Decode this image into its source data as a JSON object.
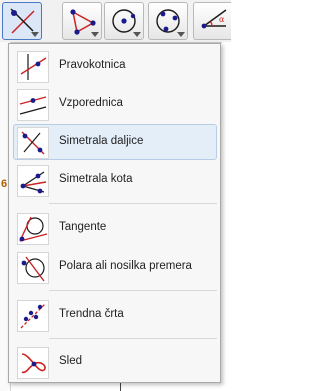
{
  "colors": {
    "accent": "#1a1a8c",
    "line_red": "#cc2222",
    "selected_bg": "#e4eef9"
  },
  "toolbar": {
    "buttons": [
      {
        "name": "perpendicular-tool-icon",
        "active": true
      },
      {
        "name": "triangle-points-tool-icon",
        "active": false
      },
      {
        "name": "circle-center-tool-icon",
        "active": false
      },
      {
        "name": "circle-three-points-tool-icon",
        "active": false
      },
      {
        "name": "angle-tool-icon",
        "active": false
      }
    ]
  },
  "side_label": "6",
  "menu": {
    "items": [
      {
        "label": "Pravokotnica",
        "icon": "perpendicular-line-icon",
        "selected": false
      },
      {
        "label": "Vzporednica",
        "icon": "parallel-line-icon",
        "selected": false
      },
      {
        "label": "Simetrala daljice",
        "icon": "perpendicular-bisector-icon",
        "selected": true
      },
      {
        "label": "Simetrala kota",
        "icon": "angle-bisector-icon",
        "selected": false
      },
      {
        "label": "Tangente",
        "icon": "tangents-icon",
        "selected": false
      },
      {
        "label": "Polara ali nosilka premera",
        "icon": "polar-line-icon",
        "selected": false
      },
      {
        "label": "Trendna črta",
        "icon": "best-fit-line-icon",
        "selected": false
      },
      {
        "label": "Sled",
        "icon": "locus-icon",
        "selected": false
      }
    ]
  }
}
